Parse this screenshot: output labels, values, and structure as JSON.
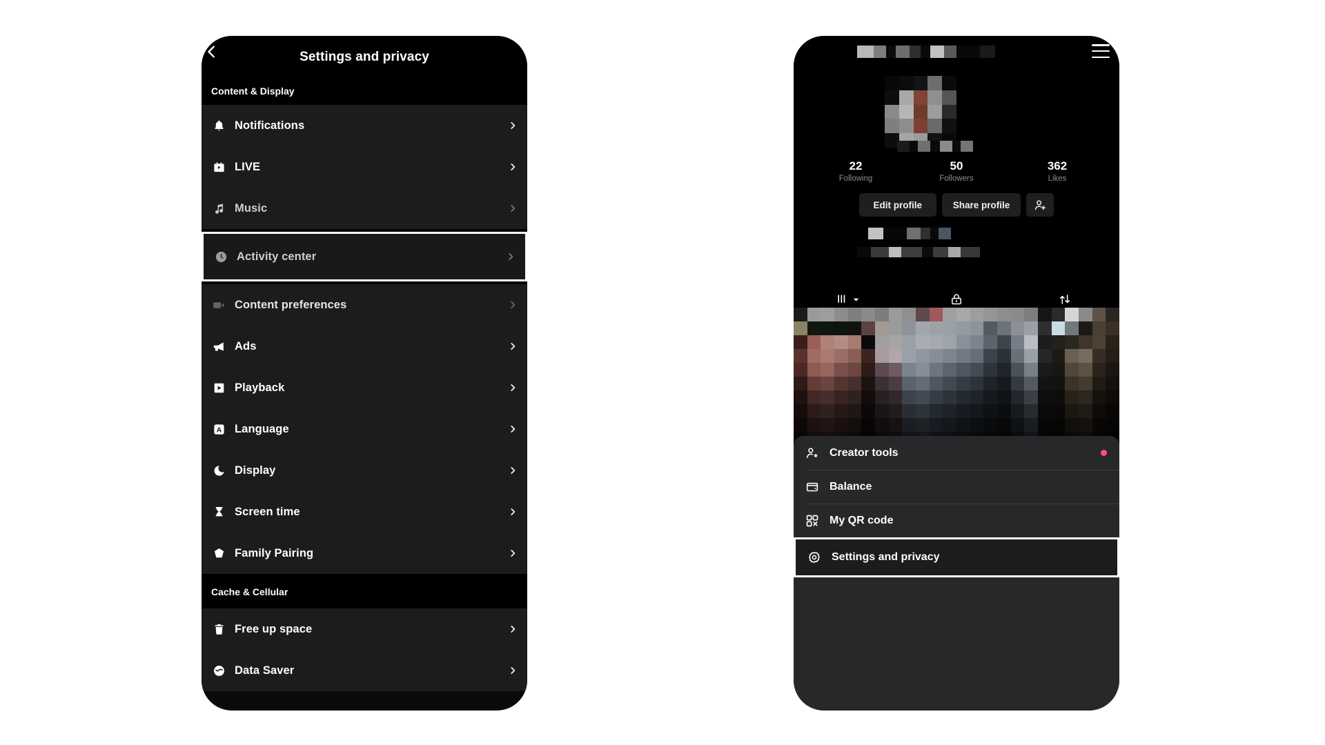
{
  "left_phone": {
    "header": {
      "title": "Settings and privacy",
      "back_icon": "back-chevron-icon"
    },
    "sections": [
      {
        "name": "Content & Display",
        "items": [
          {
            "label": "Notifications",
            "icon": "bell-icon",
            "state": "normal"
          },
          {
            "label": "LIVE",
            "icon": "live-tv-icon",
            "state": "normal"
          },
          {
            "label": "Music",
            "icon": "music-note-icon",
            "state": "dim"
          },
          {
            "label": "Activity center",
            "icon": "clock-icon",
            "state": "selected"
          },
          {
            "label": "Content preferences",
            "icon": "video-camera-icon",
            "state": "dimmer"
          },
          {
            "label": "Ads",
            "icon": "megaphone-icon",
            "state": "normal"
          },
          {
            "label": "Playback",
            "icon": "play-square-icon",
            "state": "normal"
          },
          {
            "label": "Language",
            "icon": "language-a-icon",
            "state": "normal"
          },
          {
            "label": "Display",
            "icon": "moon-icon",
            "state": "normal"
          },
          {
            "label": "Screen time",
            "icon": "hourglass-icon",
            "state": "normal"
          },
          {
            "label": "Family Pairing",
            "icon": "home-shield-icon",
            "state": "normal"
          }
        ]
      },
      {
        "name": "Cache & Cellular",
        "items": [
          {
            "label": "Free up space",
            "icon": "trash-icon",
            "state": "normal"
          },
          {
            "label": "Data Saver",
            "icon": "data-saver-icon",
            "state": "normal"
          }
        ]
      }
    ],
    "row_arrow_icon": "chevron-right-icon"
  },
  "right_phone": {
    "menu_icon": "hamburger-menu-icon",
    "username_redacted": true,
    "avatar_redacted": true,
    "handle_redacted": true,
    "stats": [
      {
        "value": "22",
        "label": "Following"
      },
      {
        "value": "50",
        "label": "Followers"
      },
      {
        "value": "362",
        "label": "Likes"
      }
    ],
    "actions": [
      {
        "label": "Edit profile",
        "type": "text"
      },
      {
        "label": "Share profile",
        "type": "text"
      },
      {
        "label": "",
        "type": "icon",
        "icon": "add-person-icon"
      }
    ],
    "tabs": [
      {
        "icon": "grid-posts-icon",
        "has_chevron": true,
        "active": true
      },
      {
        "icon": "lock-private-icon",
        "has_chevron": false,
        "active": false
      },
      {
        "icon": "repost-icon",
        "has_chevron": false,
        "active": false
      }
    ],
    "sheet_items": [
      {
        "label": "Creator tools",
        "icon": "creator-star-icon",
        "badge": true,
        "selected": false
      },
      {
        "label": "Balance",
        "icon": "wallet-icon",
        "badge": false,
        "selected": false
      },
      {
        "label": "My QR code",
        "icon": "qr-code-icon",
        "badge": false,
        "selected": false
      },
      {
        "label": "Settings and privacy",
        "icon": "gear-settings-icon",
        "badge": false,
        "selected": true
      }
    ]
  },
  "colors": {
    "page_bg": "#ffffff",
    "phone_bg": "#0a0a0a",
    "section_header_bg": "#000000",
    "list_row_bg": "#1c1c1e",
    "sheet_bg": "#28282b",
    "selection_border": "#ffffff",
    "badge_pink": "#ff4d88",
    "caption_gray": "#8e8e93"
  }
}
